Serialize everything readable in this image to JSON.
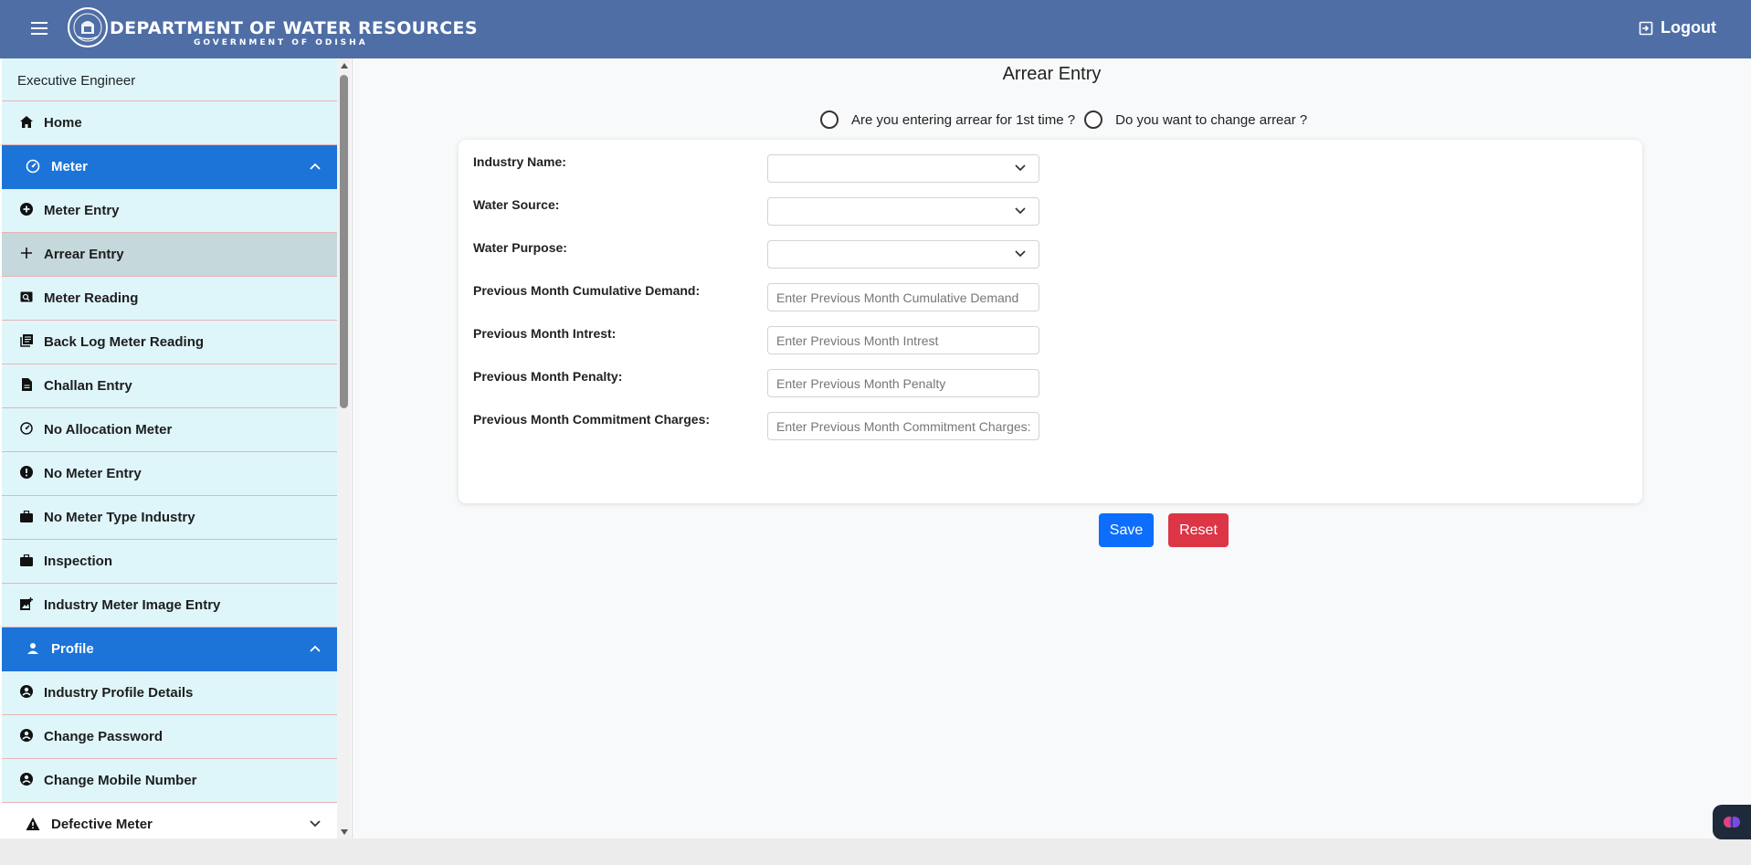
{
  "header": {
    "title": "DEPARTMENT OF WATER RESOURCES",
    "subtitle": "GOVERNMENT OF ODISHA",
    "logout_label": "Logout",
    "menu_icon": "hamburger-icon",
    "logout_icon": "logout-icon",
    "bg_color": "#4f6ea6"
  },
  "sidebar": {
    "user_role": "Executive Engineer",
    "home": {
      "label": "Home",
      "icon": "home-icon"
    },
    "meter_section": {
      "label": "Meter",
      "icon": "gauge-icon",
      "expanded": true,
      "color": "#1c74d9"
    },
    "meter_items": [
      {
        "label": "Meter Entry",
        "icon": "plus-circle-icon"
      },
      {
        "label": "Arrear Entry",
        "icon": "plus-icon",
        "active": true
      },
      {
        "label": "Meter Reading",
        "icon": "meter-reading-icon"
      },
      {
        "label": "Back Log Meter Reading",
        "icon": "library-books-icon"
      },
      {
        "label": "Challan Entry",
        "icon": "file-icon"
      },
      {
        "label": "No Allocation Meter",
        "icon": "gauge-icon"
      },
      {
        "label": "No Meter Entry",
        "icon": "alert-circle-icon"
      },
      {
        "label": "No Meter Type Industry",
        "icon": "briefcase-icon"
      },
      {
        "label": "Inspection",
        "icon": "briefcase-icon"
      },
      {
        "label": "Industry Meter Image Entry",
        "icon": "add-photo-icon"
      }
    ],
    "profile_section": {
      "label": "Profile",
      "icon": "person-icon",
      "expanded": true
    },
    "profile_items": [
      {
        "label": "Industry Profile Details",
        "icon": "account-circle-icon"
      },
      {
        "label": "Change Password",
        "icon": "account-circle-icon"
      },
      {
        "label": "Change Mobile Number",
        "icon": "account-circle-icon"
      }
    ],
    "defective_section": {
      "label": "Defective Meter",
      "icon": "warning-icon",
      "expanded": false
    }
  },
  "main": {
    "title": "Arrear Entry",
    "radio_options": [
      {
        "label": "Are you entering arrear for 1st time ?",
        "selected": false
      },
      {
        "label": "Do you want to change arrear ?",
        "selected": false
      }
    ],
    "form": {
      "fields": [
        {
          "label": "Industry Name:",
          "type": "select",
          "value": "",
          "placeholder": ""
        },
        {
          "label": "Water Source:",
          "type": "select",
          "value": "",
          "placeholder": ""
        },
        {
          "label": "Water Purpose:",
          "type": "select",
          "value": "",
          "placeholder": ""
        },
        {
          "label": "Previous Month Cumulative Demand:",
          "type": "text",
          "value": "",
          "placeholder": "Enter Previous Month Cumulative Demand"
        },
        {
          "label": "Previous Month Intrest:",
          "type": "text",
          "value": "",
          "placeholder": "Enter Previous Month Intrest"
        },
        {
          "label": "Previous Month Penalty:",
          "type": "text",
          "value": "",
          "placeholder": "Enter Previous Month Penalty"
        },
        {
          "label": "Previous Month Commitment Charges:",
          "type": "text",
          "value": "",
          "placeholder": "Enter Previous Month Commitment Charges:"
        }
      ],
      "save_label": "Save",
      "reset_label": "Reset",
      "save_color": "#0d6efd",
      "reset_color": "#dc3545"
    }
  }
}
